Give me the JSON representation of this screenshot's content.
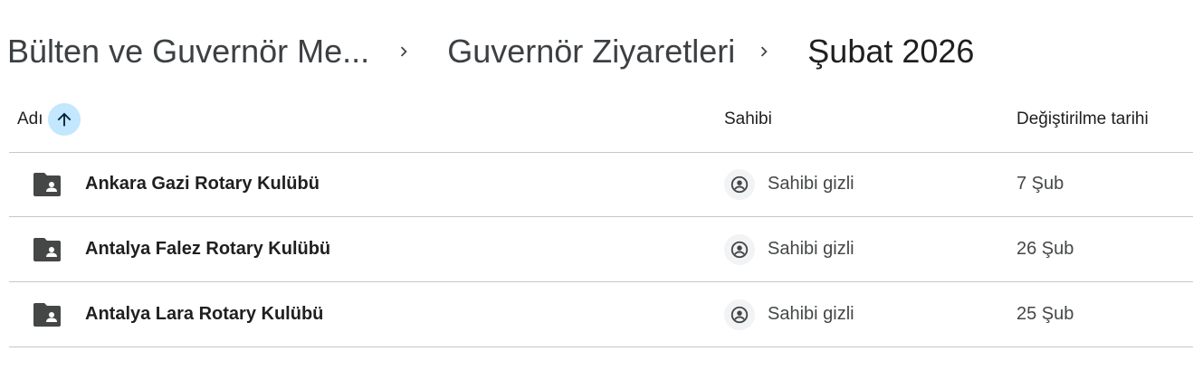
{
  "breadcrumb": {
    "items": [
      {
        "label": "Bülten ve Guvernör Me..."
      },
      {
        "label": "Guvernör Ziyaretleri"
      },
      {
        "label": "Şubat 2026"
      }
    ],
    "separator_icon": "chevron-right-icon"
  },
  "table": {
    "headers": {
      "name": "Adı",
      "owner": "Sahibi",
      "modified": "Değiştirilme tarihi"
    },
    "sort": {
      "column": "name",
      "direction": "ascending",
      "icon": "arrow-up-icon"
    },
    "rows": [
      {
        "icon": "shared-folder-icon",
        "name": "Ankara Gazi Rotary Kulübü",
        "owner": "Sahibi gizli",
        "modified": "7 Şub"
      },
      {
        "icon": "shared-folder-icon",
        "name": "Antalya Falez Rotary Kulübü",
        "owner": "Sahibi gizli",
        "modified": "26 Şub"
      },
      {
        "icon": "shared-folder-icon",
        "name": "Antalya Lara Rotary Kulübü",
        "owner": "Sahibi gizli",
        "modified": "25 Şub"
      }
    ]
  },
  "colors": {
    "sort_accent": "#c2e7ff",
    "divider": "#c7c7c7",
    "folder": "#444746"
  }
}
